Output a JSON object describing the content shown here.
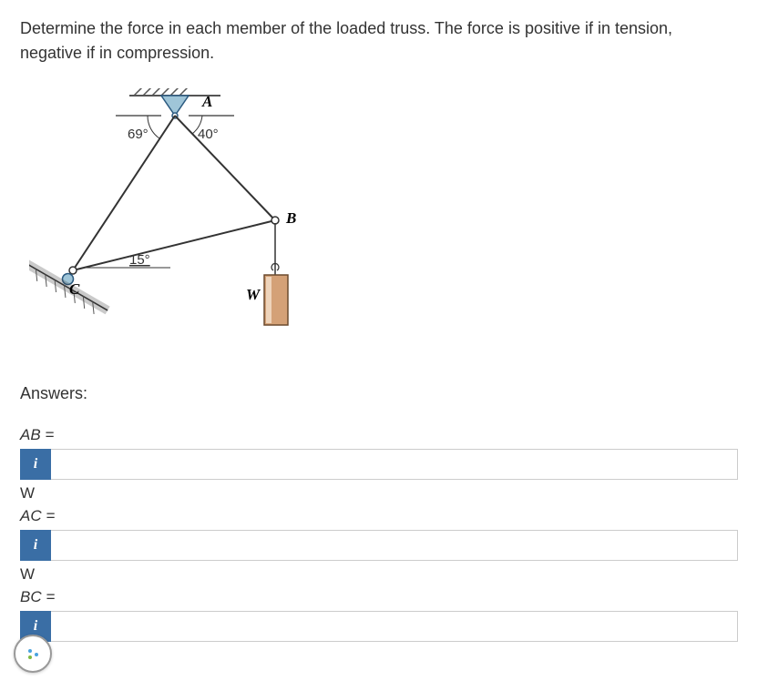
{
  "problem": {
    "text": "Determine the force in each member of the loaded truss. The force is positive if in tension, negative if in compression."
  },
  "figure": {
    "pointA": "A",
    "pointB": "B",
    "pointC": "C",
    "angle1": "69°",
    "angle2": "40°",
    "angle3": "15°",
    "load": "W"
  },
  "answers": {
    "label": "Answers:",
    "rows": [
      {
        "name": "AB =",
        "unit": "W",
        "info": "i",
        "value": ""
      },
      {
        "name": "AC =",
        "unit": "W",
        "info": "i",
        "value": ""
      },
      {
        "name": "BC =",
        "unit": "",
        "info": "i",
        "value": ""
      }
    ]
  }
}
